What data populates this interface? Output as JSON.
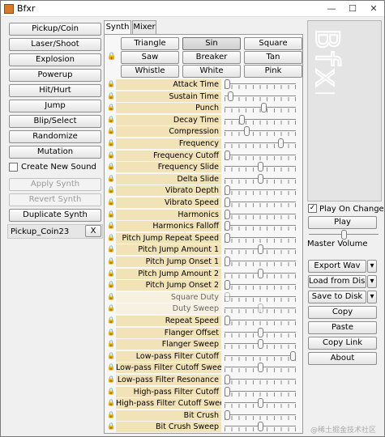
{
  "window": {
    "title": "Bfxr",
    "controls": [
      "—",
      "☐",
      "✕"
    ]
  },
  "left": {
    "buttons": [
      "Pickup/Coin",
      "Laser/Shoot",
      "Explosion",
      "Powerup",
      "Hit/Hurt",
      "Jump",
      "Blip/Select",
      "Randomize",
      "Mutation"
    ],
    "create_new_sound_label": "Create New Sound",
    "create_new_sound_checked": false,
    "apply_synth": "Apply Synth",
    "revert_synth": "Revert Synth",
    "duplicate_synth": "Duplicate Synth",
    "sound_name": "Pickup_Coin23",
    "delete_label": "X"
  },
  "tabs": [
    {
      "label": "Synth",
      "active": true
    },
    {
      "label": "Mixer",
      "active": false
    }
  ],
  "waveforms": [
    {
      "label": "Triangle",
      "selected": false
    },
    {
      "label": "Sin",
      "selected": true
    },
    {
      "label": "Square",
      "selected": false
    },
    {
      "label": "Saw",
      "selected": false
    },
    {
      "label": "Breaker",
      "selected": false
    },
    {
      "label": "Tan",
      "selected": false
    },
    {
      "label": "Whistle",
      "selected": false
    },
    {
      "label": "White",
      "selected": false
    },
    {
      "label": "Pink",
      "selected": false
    }
  ],
  "params": [
    {
      "name": "Attack Time",
      "value": 0.0,
      "enabled": true
    },
    {
      "name": "Sustain Time",
      "value": 0.05,
      "enabled": true
    },
    {
      "name": "Punch",
      "value": 0.55,
      "enabled": true
    },
    {
      "name": "Decay Time",
      "value": 0.22,
      "enabled": true
    },
    {
      "name": "Compression",
      "value": 0.3,
      "enabled": true
    },
    {
      "name": "Frequency",
      "value": 0.82,
      "enabled": true
    },
    {
      "name": "Frequency Cutoff",
      "value": 0.0,
      "enabled": true
    },
    {
      "name": "Frequency Slide",
      "value": 0.5,
      "enabled": true
    },
    {
      "name": "Delta Slide",
      "value": 0.5,
      "enabled": true
    },
    {
      "name": "Vibrato Depth",
      "value": 0.0,
      "enabled": true
    },
    {
      "name": "Vibrato Speed",
      "value": 0.0,
      "enabled": true
    },
    {
      "name": "Harmonics",
      "value": 0.0,
      "enabled": true
    },
    {
      "name": "Harmonics Falloff",
      "value": 0.0,
      "enabled": true
    },
    {
      "name": "Pitch Jump Repeat Speed",
      "value": 0.0,
      "enabled": true
    },
    {
      "name": "Pitch Jump Amount 1",
      "value": 0.5,
      "enabled": true
    },
    {
      "name": "Pitch Jump Onset 1",
      "value": 0.0,
      "enabled": true
    },
    {
      "name": "Pitch Jump Amount 2",
      "value": 0.5,
      "enabled": true
    },
    {
      "name": "Pitch Jump Onset 2",
      "value": 0.0,
      "enabled": true
    },
    {
      "name": "Square Duty",
      "value": 0.0,
      "enabled": false
    },
    {
      "name": "Duty Sweep",
      "value": 0.5,
      "enabled": false
    },
    {
      "name": "Repeat Speed",
      "value": 0.0,
      "enabled": true
    },
    {
      "name": "Flanger Offset",
      "value": 0.5,
      "enabled": true
    },
    {
      "name": "Flanger Sweep",
      "value": 0.5,
      "enabled": true
    },
    {
      "name": "Low-pass Filter Cutoff",
      "value": 1.0,
      "enabled": true
    },
    {
      "name": "Low-pass Filter Cutoff Sweep",
      "value": 0.5,
      "enabled": true
    },
    {
      "name": "Low-pass Filter Resonance",
      "value": 0.0,
      "enabled": true
    },
    {
      "name": "High-pass Filter Cutoff",
      "value": 0.0,
      "enabled": true
    },
    {
      "name": "High-pass Filter Cutoff Sweep",
      "value": 0.5,
      "enabled": true
    },
    {
      "name": "Bit Crush",
      "value": 0.0,
      "enabled": true
    },
    {
      "name": "Bit Crush Sweep",
      "value": 0.5,
      "enabled": true
    }
  ],
  "right": {
    "logo_text": "Bfxr",
    "play_on_change_label": "Play On Change",
    "play_on_change_checked": true,
    "play": "Play",
    "master_volume_label": "Master Volume",
    "master_volume": 0.5,
    "export_wav": "Export Wav",
    "load_from_disk": "Load from Disk",
    "save_to_disk": "Save to Disk",
    "copy": "Copy",
    "paste": "Paste",
    "copy_link": "Copy Link",
    "about": "About",
    "dropdown_arrow": "▾"
  },
  "watermark": "@稀土掘金技术社区"
}
